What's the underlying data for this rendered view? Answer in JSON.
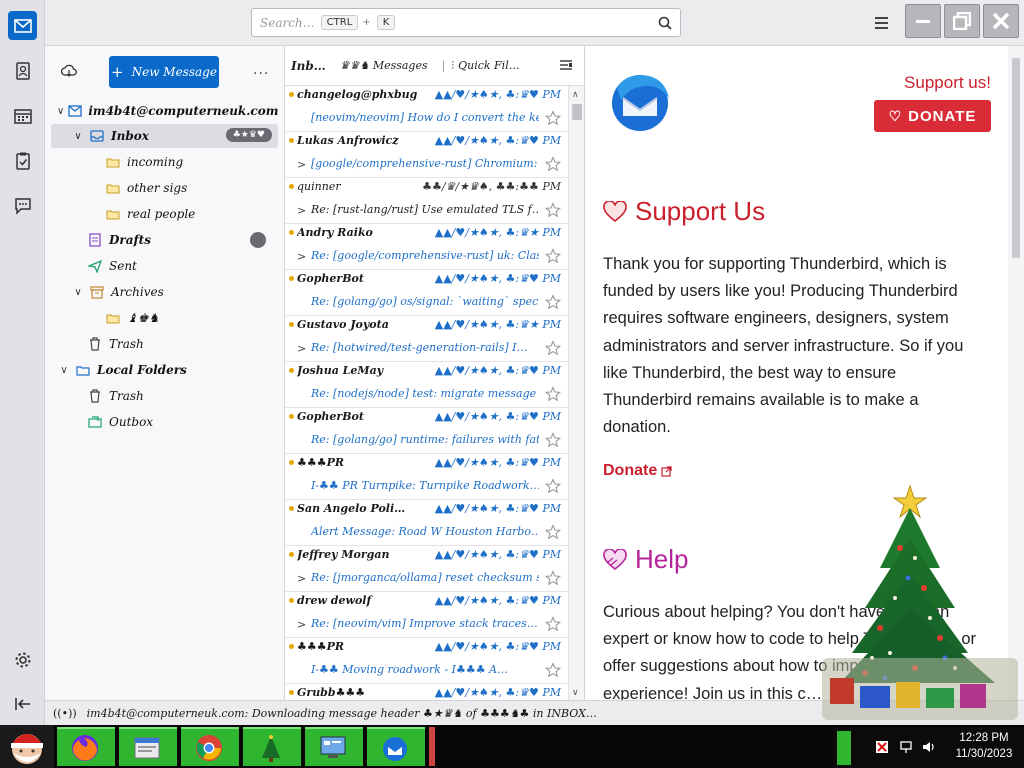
{
  "titlebar": {
    "search_placeholder": "Search…",
    "shortcut_ctrl": "CTRL",
    "shortcut_sep": "+",
    "shortcut_key": "K"
  },
  "spaces": [
    "mail-icon",
    "address-book-icon",
    "calendar-icon",
    "tasks-icon",
    "chat-icon",
    "settings-icon",
    "collapse-icon"
  ],
  "folder_pane": {
    "new_message_label": "New Message",
    "more_label": "...",
    "folders": [
      {
        "label": "im4b4t@computerneuk.com"
      },
      {
        "label": "Inbox",
        "count": "♣★♛♥"
      },
      {
        "label": "incoming"
      },
      {
        "label": "other sigs"
      },
      {
        "label": "real people"
      },
      {
        "label": "Drafts"
      },
      {
        "label": "Sent"
      },
      {
        "label": "Archives"
      },
      {
        "label": "♝♚♞"
      },
      {
        "label": "Trash"
      },
      {
        "label": "Local Folders"
      },
      {
        "label": "Trash"
      },
      {
        "label": "Outbox"
      }
    ]
  },
  "message_list": {
    "header_title": "Inb…",
    "header_count": "♛♛♞ Messages",
    "quick_filter": "Quick Fil…",
    "rows": [
      {
        "from": "changelog@phxbug",
        "date": "▲▲/♥/★♠★, ♣:♛♥ PM",
        "subject": "[neovim/neovim] How do I convert the key…",
        "thread": false
      },
      {
        "from": "Lukas Anfrowicz",
        "date": "▲▲/♥/★♠★, ♣:♛♥ PM",
        "subject": "[google/comprehensive-rust] Chromium: Co…",
        "thread": true
      },
      {
        "from": "quinner",
        "date": "♣♣/♛/★♛♠, ♣♣:♣♣ PM",
        "subject": "Re: [rust-lang/rust] Use emulated TLS f…",
        "thread": true,
        "plain": true
      },
      {
        "from": "Andry Raiko",
        "date": "▲▲/♥/★♠★, ♣:♛★ PM",
        "subject": "Re: [google/comprehensive-rust] uk: Clas…",
        "thread": true
      },
      {
        "from": "GopherBot",
        "date": "▲▲/♥/★♠★, ♣:♛♥ PM",
        "subject": "Re: [golang/go] os/signal: `waiting` special…",
        "thread": false
      },
      {
        "from": "Gustavo Joyota",
        "date": "▲▲/♥/★♠★, ♣:♛★ PM",
        "subject": "Re: [hotwired/test-generation-rails] I…",
        "thread": true
      },
      {
        "from": "Joshua LeMay",
        "date": "▲▲/♥/★♠★, ♣:♛♥ PM",
        "subject": "Re: [nodejs/node] test: migrate message util…",
        "thread": false
      },
      {
        "from": "GopherBot",
        "date": "▲▲/♥/★♠★, ♣:♛♥ PM",
        "subject": "Re: [golang/go] runtime: failures with fatal…",
        "thread": false
      },
      {
        "from": "♣♣♣PR",
        "date": "▲▲/♥/★♠★, ♣:♛♥ PM",
        "subject": "I-♣♣ PR Turnpike: Turnpike Roadwork…",
        "thread": false
      },
      {
        "from": "San Angelo Poli…",
        "date": "▲▲/♥/★♠★, ♣:♛♥ PM",
        "subject": "Alert Message: Road W Houston Harbo…",
        "thread": false
      },
      {
        "from": "Jeffrey Morgan",
        "date": "▲▲/♥/★♠★, ♣:♛♥ PM",
        "subject": "Re: [jmorganca/ollama] reset checksum s…",
        "thread": true
      },
      {
        "from": "drew dewolf",
        "date": "▲▲/♥/★♠★, ♣:♛♥ PM",
        "subject": "Re: [neovim/vim] Improve stack traces…",
        "thread": true
      },
      {
        "from": "♣♣♣PR",
        "date": "▲▲/♥/★♠★, ♣:♛♥ PM",
        "subject": "I-♣♣ Moving roadwork - I♣♣♣ A…",
        "thread": false
      },
      {
        "from": "Grubb♣♣♣",
        "date": "▲▲/♥/★♠★, ♣:♛♥ PM",
        "subject": "",
        "thread": false
      }
    ]
  },
  "content": {
    "support_link": "Support us!",
    "donate_button": "DONATE",
    "section1_title": "Support Us",
    "section1_text": "Thank you for supporting Thunderbird, which is funded by users like you! Producing Thunderbird requires software engineers, designers, system administrators and server infrastructure. So if you like Thunderbird, the best way to ensure Thunderbird remains available is to make a donation.",
    "donate_link": "Donate",
    "section2_title": "Help",
    "section2_text": "Curious about helping? You don't have to be an expert or know how to code to help Thunderbird, or offer suggestions about how to improve the experience! Join us in this c…"
  },
  "statusbar": {
    "text": "im4b4t@computerneuk.com: Downloading message header ♣★♛♞ of ♣♣♣♞♣ in INBOX…"
  },
  "taskbar": {
    "apps": [
      "santa-start-icon",
      "firefox-icon",
      "file-manager-icon",
      "chrome-icon",
      "tree-icon",
      "control-panel-icon",
      "thunderbird-icon"
    ],
    "time": "12:28 PM",
    "date": "11/30/2023"
  },
  "colors": {
    "accent": "#0b6ac9",
    "support_red": "#cc1f2d",
    "help_magenta": "#b5259a",
    "taskbar_green": "#2fb52f"
  }
}
